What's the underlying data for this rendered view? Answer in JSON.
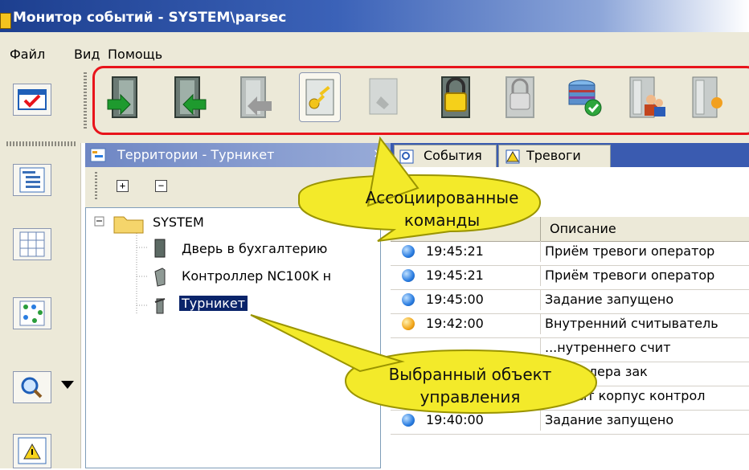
{
  "window": {
    "title": "Монитор событий - SYSTEM\\parsec"
  },
  "menu": [
    "Файл",
    "Вид",
    "Помощь"
  ],
  "left_toolbar": {
    "icons": [
      "checklist-icon",
      "tree-view-icon",
      "grid-view-icon",
      "network-icon",
      "search-icon",
      "alarm-icon"
    ]
  },
  "toolbar": {
    "buttons": [
      "door-enter-icon",
      "door-exit-icon",
      "door-pass-icon",
      "key-icon",
      "unlock-icon",
      "lock-icon",
      "lock-blocked-icon",
      "server-ok-icon",
      "access-group-icon",
      "door-extra-icon"
    ]
  },
  "territory_panel": {
    "title": "Территории - Турникет",
    "close": "×",
    "expand_all": "+",
    "collapse_all": "−",
    "tree": {
      "root": "SYSTEM",
      "children": [
        "Дверь в бухгалтерию",
        "Контроллер NC100K н",
        "Турникет"
      ],
      "selected": "Турникет"
    }
  },
  "events_panel": {
    "tabs": [
      "События",
      "Тревоги"
    ],
    "columns": {
      "description": "Описание"
    },
    "rows": [
      {
        "time": "19:45:21",
        "desc": "Приём тревоги оператор",
        "status": "blue"
      },
      {
        "time": "19:45:21",
        "desc": "Приём тревоги оператор",
        "status": "blue"
      },
      {
        "time": "19:45:00",
        "desc": "Задание запущено",
        "status": "blue"
      },
      {
        "time": "19:42:00",
        "desc": "Внутренний считыватель",
        "status": "orange"
      },
      {
        "time": "",
        "desc": "...нутреннего счит",
        "status": "none"
      },
      {
        "time": "",
        "desc": "...троллера зак",
        "status": "none"
      },
      {
        "time": "",
        "desc": "Вскрыт корпус контрол",
        "status": "none"
      },
      {
        "time": "19:40:00",
        "desc": "Задание запущено",
        "status": "blue"
      }
    ]
  },
  "callouts": {
    "associated_commands": "Ассоциированные команды",
    "selected_object": "Выбранный объект управления"
  },
  "colors": {
    "title_bar": "#1d3f8f",
    "highlight_border": "#e8141b",
    "callout_fill": "#f3ea2a",
    "selection": "#0a246a"
  }
}
